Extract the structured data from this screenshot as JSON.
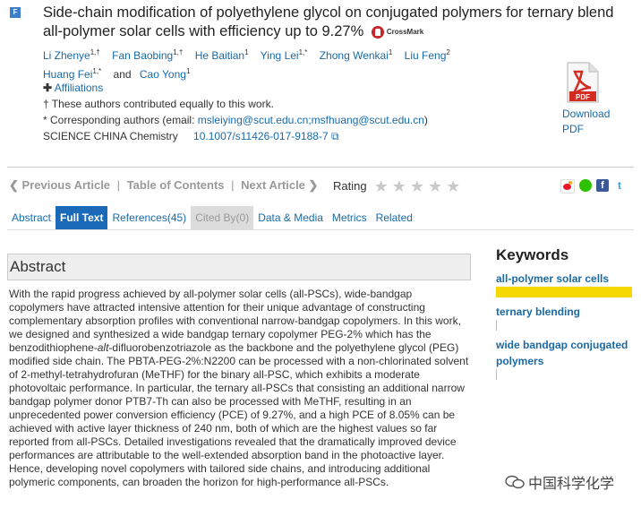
{
  "article": {
    "badge": "F",
    "title": "Side-chain modification of polyethylene glycol on conjugated polymers for ternary blend all-polymer solar cells with efficiency up to 9.27%",
    "crossmark_label": "CrossMark",
    "authors": [
      {
        "name": "Li Zhenye",
        "sup": "1,†"
      },
      {
        "name": "Fan Baobing",
        "sup": "1,†"
      },
      {
        "name": "He Baitian",
        "sup": "1"
      },
      {
        "name": "Ying Lei",
        "sup": "1,*"
      },
      {
        "name": "Zhong Wenkai",
        "sup": "1"
      },
      {
        "name": "Liu Feng",
        "sup": "2"
      },
      {
        "name": "Huang Fei",
        "sup": "1,*"
      },
      {
        "name": "Cao Yong",
        "sup": "1"
      }
    ],
    "and_word": "and",
    "affiliations_label": "Affiliations",
    "contrib_note": "† These authors contributed equally to this work.",
    "corr_prefix": "* Corresponding authors (email: ",
    "corr_emails": "msleiying@scut.edu.cn;msfhuang@scut.edu.cn",
    "corr_suffix": ")",
    "journal": "SCIENCE CHINA Chemistry",
    "doi": "10.1007/s11426-017-9188-7"
  },
  "pdf": {
    "icon_text": "PDF",
    "download": "Download",
    "pdf_label": "PDF"
  },
  "nav": {
    "prev": "Previous Article",
    "toc": "Table of Contents",
    "next": "Next Article",
    "sep": "|",
    "rating": "Rating",
    "stars": 0
  },
  "tabs": [
    {
      "label": "Abstract",
      "state": "normal"
    },
    {
      "label": "Full Text",
      "state": "active"
    },
    {
      "label": "References(45)",
      "state": "normal"
    },
    {
      "label": "Cited By(0)",
      "state": "disabled"
    },
    {
      "label": "Data & Media",
      "state": "normal"
    },
    {
      "label": "Metrics",
      "state": "normal"
    },
    {
      "label": "Related",
      "state": "normal"
    }
  ],
  "abstract": {
    "heading": "Abstract",
    "text_a": "With the rapid progress achieved by all-polymer solar cells (all-PSCs), wide-bandgap copolymers have attracted intensive attention for their unique advantage of constructing complementary absorption profiles with conventional narrow-bandgap copolymers. In this work, we designed and synthesized a wide bandgap ternary copolymer PEG-2% which has the benzodithiophene-",
    "text_alt": "alt",
    "text_b": "-difluorobenzotriazole as the backbone and the polyethylene glycol (PEG) modified side chain. The PBTA-PEG-2%:N2200 can be processed with a non-chlorinated solvent of 2-methyl-tetrahydrofuran (MeTHF) for the binary all-PSC, which exhibits a moderate photovoltaic performance. In particular, the ternary all-PSCs that consisting an additional narrow bandgap polymer donor PTB7-Th can also be processed with MeTHF, resulting in an unprecedented power conversion efficiency (PCE) of 9.27%, and a high PCE of 8.05% can be achieved with active layer thickness of 240 nm, both of which are the highest values so far reported from all-PSCs. Detailed investigations revealed that the dramatically improved device performances are attributable to the well-extended absorption band in the photoactive layer. Hence, developing novel copolymers with tailored side chains, and introducing additional polymeric components, can broaden the horizon for high-performance all-PSCs."
  },
  "keywords": {
    "heading": "Keywords",
    "items": [
      "all-polymer solar cells",
      "ternary blending",
      "wide bandgap conjugated polymers"
    ]
  },
  "watermark": {
    "text": "中国科学化学"
  },
  "colors": {
    "link": "#1a6aa8",
    "active_tab": "#1a6ab8",
    "highlight": "#f5d800"
  }
}
